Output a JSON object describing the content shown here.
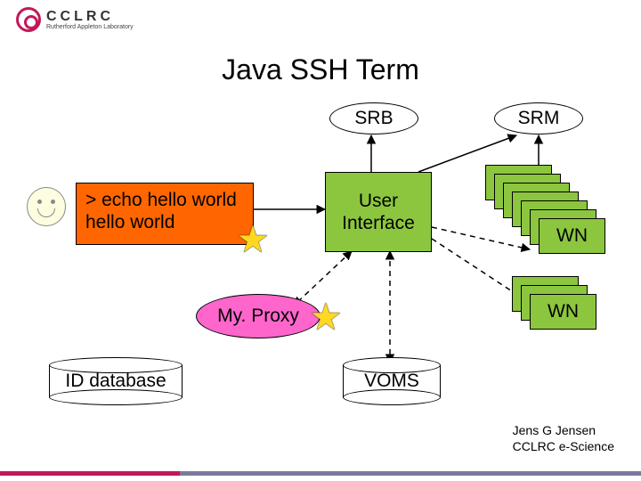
{
  "brand": {
    "name": "CCLRC",
    "subtitle": "Rutherford Appleton Laboratory"
  },
  "title": "Java SSH Term",
  "nodes": {
    "srb": "SRB",
    "srm": "SRM",
    "terminal_line1": "> echo hello world",
    "terminal_line2": "hello world",
    "user_interface": "User\nInterface",
    "wn1": "WN",
    "wn2": "WN",
    "myproxy": "My. Proxy",
    "id_database": "ID database",
    "voms": "VOMS"
  },
  "footer": {
    "author": "Jens G Jensen",
    "affiliation": "CCLRC e-Science"
  }
}
